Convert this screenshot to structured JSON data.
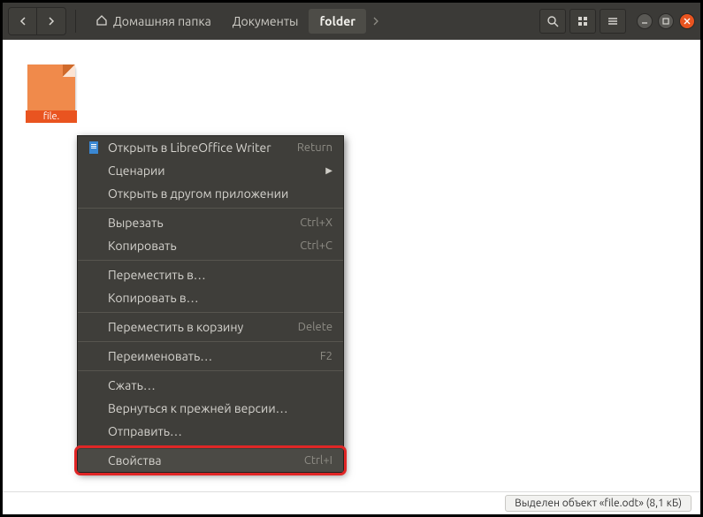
{
  "breadcrumbs": {
    "home": "Домашняя папка",
    "docs": "Документы",
    "folder": "folder"
  },
  "file": {
    "label": "file."
  },
  "menu": {
    "open_with": "Открыть в LibreOffice Writer",
    "open_with_accel": "Return",
    "scenarios": "Сценарии",
    "open_other": "Открыть в другом приложении",
    "cut": "Вырезать",
    "cut_accel": "Ctrl+X",
    "copy": "Копировать",
    "copy_accel": "Ctrl+C",
    "move_to": "Переместить в…",
    "copy_to": "Копировать в…",
    "trash": "Переместить в корзину",
    "trash_accel": "Delete",
    "rename": "Переименовать…",
    "rename_accel": "F2",
    "compress": "Сжать…",
    "revert": "Вернуться к прежней версии…",
    "send": "Отправить…",
    "properties": "Свойства",
    "properties_accel": "Ctrl+I"
  },
  "statusbar": {
    "text": "Выделен объект «file.odt»  (8,1 кБ)"
  }
}
